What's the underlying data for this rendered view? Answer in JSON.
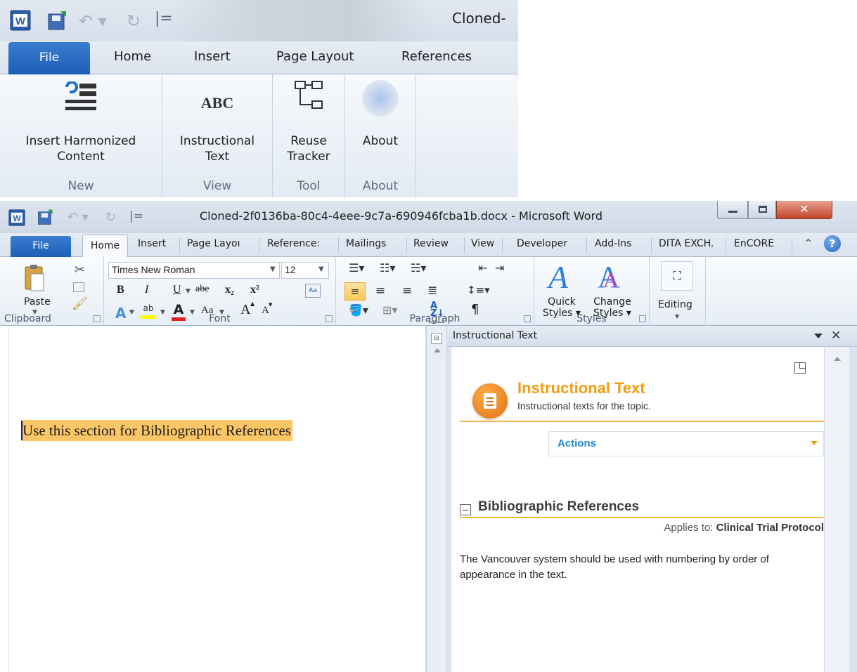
{
  "top_crop": {
    "title": "Cloned-",
    "tabs": [
      "File",
      "Home",
      "Insert",
      "Page Layout",
      "References"
    ],
    "groups": [
      {
        "button_lines": [
          "Insert Harmonized",
          "Content"
        ],
        "label": "New"
      },
      {
        "button_lines": [
          "Instructional",
          "Text"
        ],
        "label": "View",
        "icon_text": "ABC"
      },
      {
        "button_lines": [
          "Reuse",
          "Tracker"
        ],
        "label": "Tool"
      },
      {
        "button_lines": [
          "About"
        ],
        "label": "About"
      }
    ]
  },
  "window": {
    "title": "Cloned-2f0136ba-80c4-4eee-9c7a-690946fcba1b.docx - Microsoft Word",
    "tabs": [
      "File",
      "Home",
      "Insert",
      "Page Layoı",
      "Reference:",
      "Mailings",
      "Review",
      "View",
      "Developer",
      "Add-Ins",
      "DITA EXCH.",
      "EnCORE"
    ],
    "ribbon": {
      "clipboard": {
        "paste": "Paste",
        "label": "Clipboard"
      },
      "font": {
        "name": "Times New Roman",
        "size": "12",
        "bold": "B",
        "italic": "I",
        "underline": "U",
        "strike": "abe",
        "sub": "x₂",
        "sup": "x²",
        "grow": "A",
        "shrink": "A",
        "case": "Aa",
        "label": "Font"
      },
      "paragraph": {
        "label": "Paragraph",
        "pilcrow": "¶"
      },
      "styles": {
        "quick": [
          "Quick",
          "Styles ▾"
        ],
        "change": [
          "Change",
          "Styles ▾"
        ],
        "label": "Styles"
      },
      "editing": {
        "label": "Editing"
      }
    }
  },
  "document": {
    "text": "Use this section for Bibliographic References"
  },
  "pane": {
    "header": "Instructional Text",
    "title": "Instructional Text",
    "subtitle": "Instructional texts for the topic.",
    "actions": "Actions",
    "section": {
      "title": "Bibliographic References",
      "applies_prefix": "Applies to: ",
      "applies_value": "Clinical Trial Protocol",
      "body": "The Vancouver system should be used with numbering by order of appearance in the text."
    }
  },
  "colors": {
    "file_tab": "#1e5fb7",
    "accent_orange": "#f39c12",
    "highlight": "#fbc766",
    "actions_blue": "#1b87c9"
  }
}
